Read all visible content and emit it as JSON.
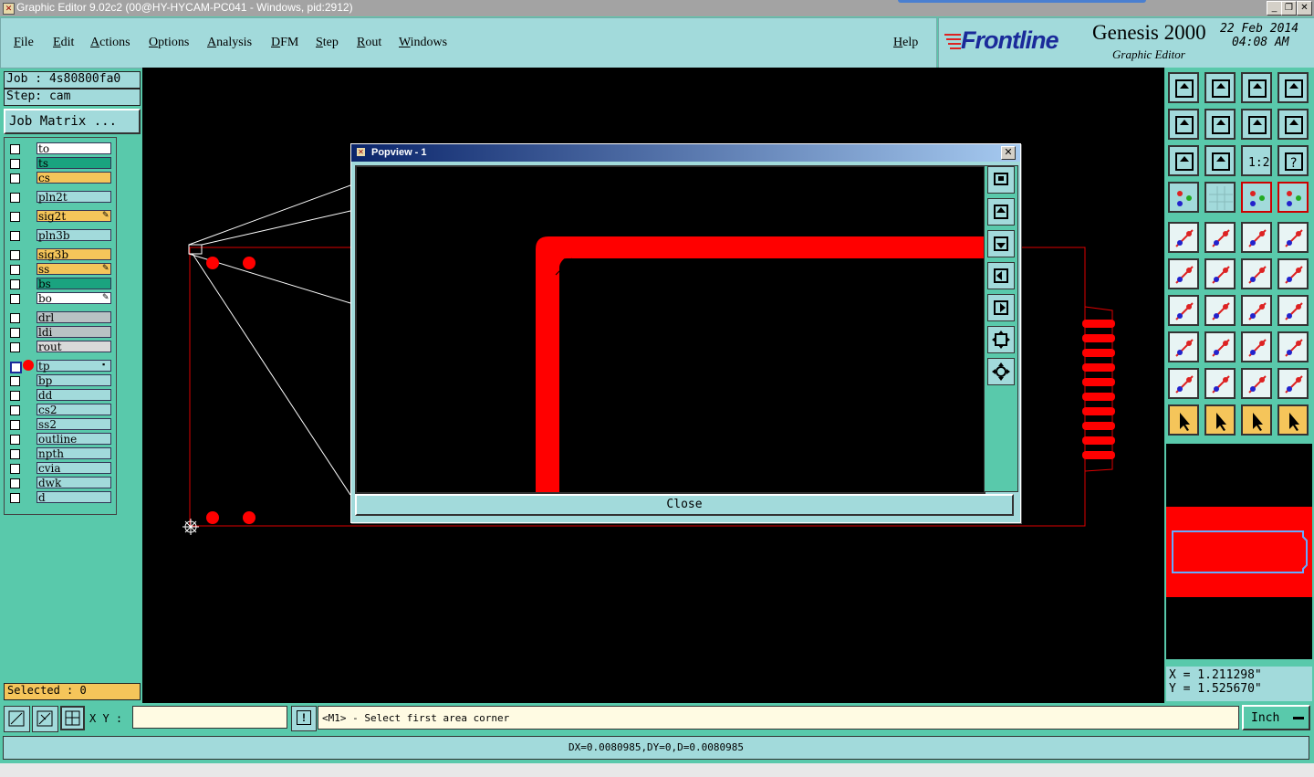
{
  "window": {
    "title": "Graphic Editor 9.02c2 (00@HY-HYCAM-PC041 - Windows, pid:2912)",
    "min_icon": "minimize-icon",
    "restore_icon": "restore-icon",
    "close_icon": "close-icon"
  },
  "menubar": {
    "items": [
      "File",
      "Edit",
      "Actions",
      "Options",
      "Analysis",
      "DFM",
      "Step",
      "Rout",
      "Windows"
    ],
    "help": "Help"
  },
  "brand": {
    "logo": "Frontline",
    "product": "Genesis 2000",
    "subtitle": "Graphic Editor",
    "date": "22 Feb 2014",
    "time": "04:08 AM"
  },
  "left": {
    "job": "Job : 4s80800fa0",
    "step": "Step: cam",
    "job_matrix": "Job Matrix ...",
    "selected": "Selected : 0",
    "layers": [
      {
        "name": "to",
        "color": "#ffffff"
      },
      {
        "name": "ts",
        "color": "#1aa37f"
      },
      {
        "name": "cs",
        "color": "#f5c55a"
      },
      {
        "name": "pln2t",
        "color": "#a2dadb"
      },
      {
        "name": "sig2t",
        "color": "#f5c55a"
      },
      {
        "name": "pln3b",
        "color": "#a2dadb"
      },
      {
        "name": "sig3b",
        "color": "#f5c55a"
      },
      {
        "name": "ss",
        "color": "#f5c55a"
      },
      {
        "name": "bs",
        "color": "#1aa37f"
      },
      {
        "name": "bo",
        "color": "#ffffff"
      },
      {
        "name": "drl",
        "color": "#b8c2c4"
      },
      {
        "name": "ldi",
        "color": "#b8c2c4"
      },
      {
        "name": "rout",
        "color": "#d9d9d9"
      },
      {
        "name": "tp",
        "color": "#a2dadb"
      },
      {
        "name": "bp",
        "color": "#a2dadb"
      },
      {
        "name": "dd",
        "color": "#a2dadb"
      },
      {
        "name": "cs2",
        "color": "#a2dadb"
      },
      {
        "name": "ss2",
        "color": "#a2dadb"
      },
      {
        "name": "outline",
        "color": "#a2dadb"
      },
      {
        "name": "npth",
        "color": "#a2dadb"
      },
      {
        "name": "cvia",
        "color": "#a2dadb"
      },
      {
        "name": "dwk",
        "color": "#a2dadb"
      },
      {
        "name": "d",
        "color": "#a2dadb"
      }
    ]
  },
  "popview": {
    "title": "Popview - 1",
    "close": "Close"
  },
  "coords": {
    "x": "X = 1.211298\"",
    "y": "Y = 1.525670\""
  },
  "bottom": {
    "xy_label": "X Y :",
    "xy_value": "",
    "prompt": "<M1> - Select first area corner",
    "units": "Inch",
    "measure": "DX=0.0080985,DY=0,D=0.0080985"
  },
  "colors": {
    "accent": "#a2dadb",
    "panel": "#59c9ab",
    "feature": "#ff0000",
    "highlight": "#f5c55a"
  }
}
